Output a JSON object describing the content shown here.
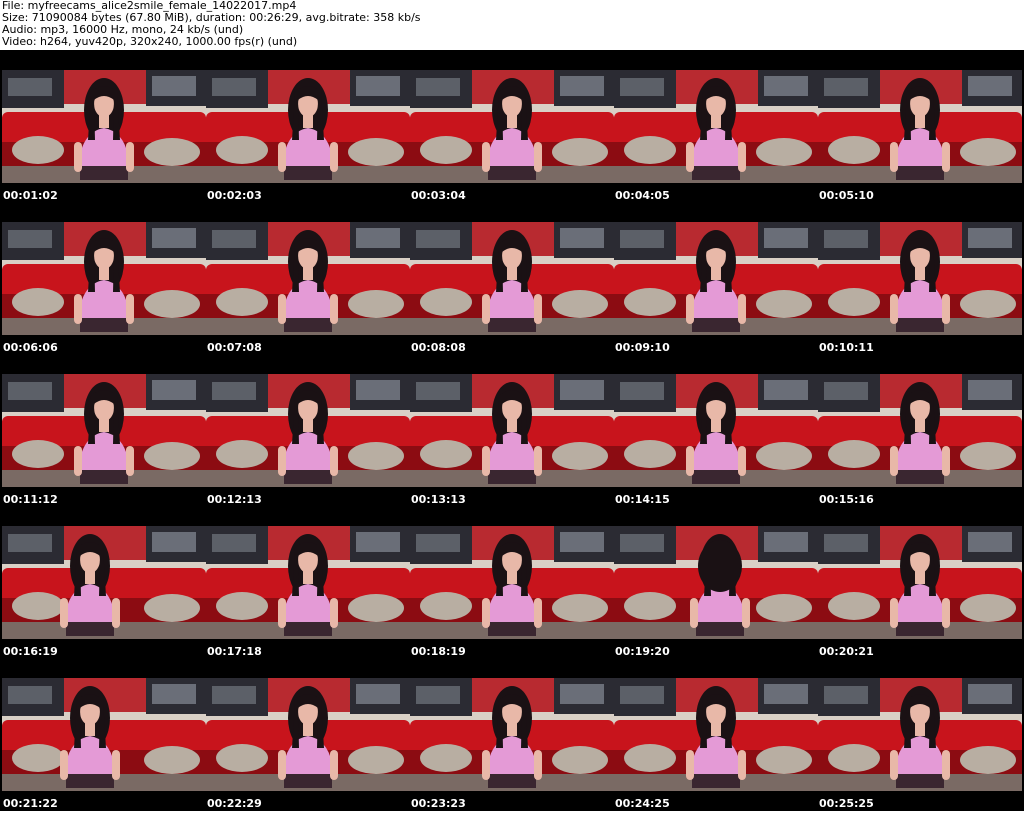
{
  "header": {
    "file_line": "File: myfreecams_alice2smile_female_14022017.mp4",
    "size_line": "Size: 71090084 bytes (67.80 MiB), duration: 00:26:29, avg.bitrate: 358 kb/s",
    "audio_line": "Audio: mp3, 16000 Hz, mono, 24 kb/s (und)",
    "video_line": "Video: h264, yuv420p, 320x240, 1000.00 fps(r) (und)"
  },
  "colors": {
    "wall": "#d9d0c6",
    "sofa": "#c8141c",
    "sofa_dark": "#8c0c12",
    "poster": "#2b2b33",
    "poster_red": "#b82a30",
    "shirt": "#e49ad6",
    "hair": "#1a1114",
    "skin": "#e8b8a8",
    "pillow": "#b8aea2",
    "skirt": "#3a2630"
  },
  "thumbnails": [
    {
      "time": "00:01:02",
      "pose": "center"
    },
    {
      "time": "00:02:03",
      "pose": "center"
    },
    {
      "time": "00:03:04",
      "pose": "center"
    },
    {
      "time": "00:04:05",
      "pose": "center"
    },
    {
      "time": "00:05:10",
      "pose": "center"
    },
    {
      "time": "00:06:06",
      "pose": "center"
    },
    {
      "time": "00:07:08",
      "pose": "center"
    },
    {
      "time": "00:08:08",
      "pose": "center"
    },
    {
      "time": "00:09:10",
      "pose": "center"
    },
    {
      "time": "00:10:11",
      "pose": "center"
    },
    {
      "time": "00:11:12",
      "pose": "center"
    },
    {
      "time": "00:12:13",
      "pose": "center"
    },
    {
      "time": "00:13:13",
      "pose": "center"
    },
    {
      "time": "00:14:15",
      "pose": "center"
    },
    {
      "time": "00:15:16",
      "pose": "center"
    },
    {
      "time": "00:16:19",
      "pose": "lean-left"
    },
    {
      "time": "00:17:18",
      "pose": "center"
    },
    {
      "time": "00:18:19",
      "pose": "center"
    },
    {
      "time": "00:19:20",
      "pose": "hair-over"
    },
    {
      "time": "00:20:21",
      "pose": "center"
    },
    {
      "time": "00:21:22",
      "pose": "lean-left"
    },
    {
      "time": "00:22:29",
      "pose": "center"
    },
    {
      "time": "00:23:23",
      "pose": "center"
    },
    {
      "time": "00:24:25",
      "pose": "center"
    },
    {
      "time": "00:25:25",
      "pose": "center"
    }
  ]
}
